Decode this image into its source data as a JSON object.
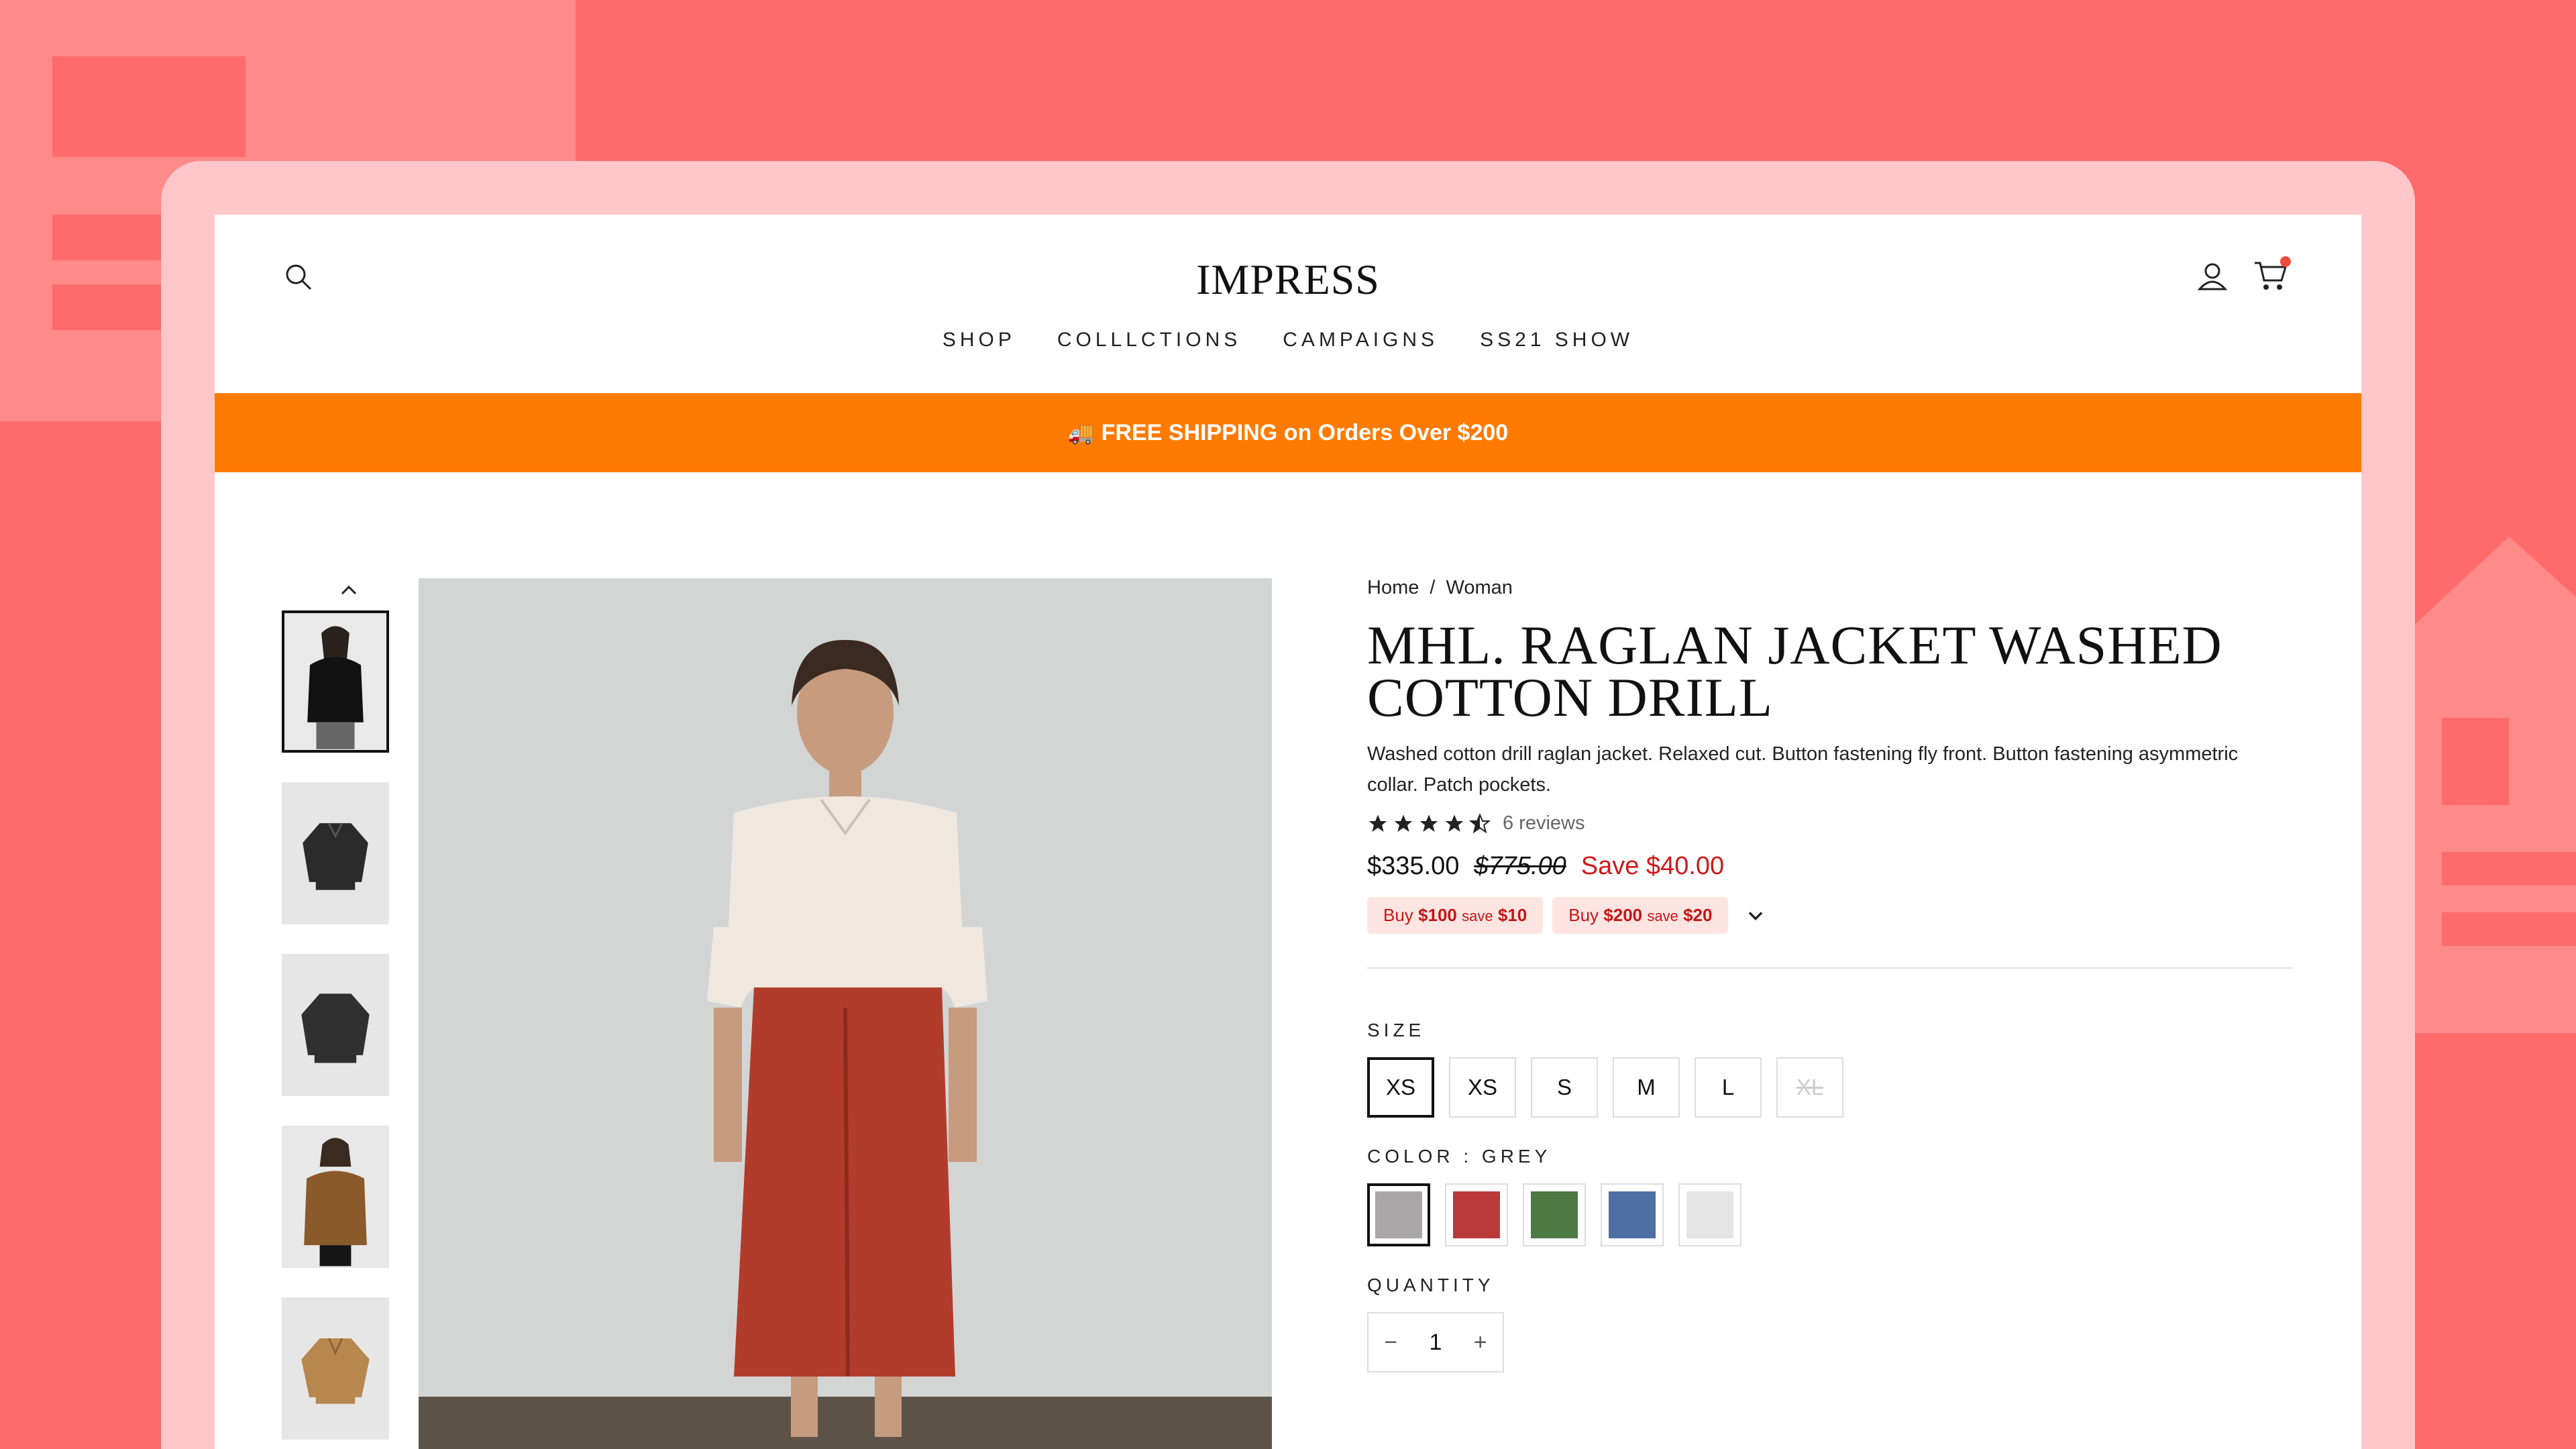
{
  "colors": {
    "background": "#ff6b6b",
    "banner": "#ff7a00",
    "sale": "#d01a1a",
    "offer_bg": "#ffe5e2"
  },
  "header": {
    "logo": "IMPRESS",
    "nav": [
      "SHOP",
      "COLLLCTIONS",
      "CAMPAIGNS",
      "SS21 SHOW"
    ],
    "icons": [
      "search-icon",
      "account-icon",
      "cart-icon"
    ]
  },
  "banner": {
    "icon": "truck-icon",
    "text": "FREE SHIPPING on Orders Over $200"
  },
  "product": {
    "breadcrumb": {
      "home": "Home",
      "separator": "/",
      "current": "Woman"
    },
    "title": "MHL. RAGLAN JACKET WASHED COTTON DRILL",
    "description": "Washed cotton drill raglan jacket. Relaxed cut. Button fastening fly front. Button fastening asymmetric collar. Patch pockets.",
    "rating": 4.5,
    "reviews": "6 reviews",
    "price": "$335.00",
    "compare_price": "$775.00",
    "save": "Save $40.00",
    "offers": [
      {
        "prefix": "Buy",
        "amount": "$100",
        "mid": "save",
        "discount": "$10"
      },
      {
        "prefix": "Buy",
        "amount": "$200",
        "mid": "save",
        "discount": "$20"
      }
    ]
  },
  "size": {
    "label": "SIZE",
    "options": [
      "XS",
      "XS",
      "S",
      "M",
      "L",
      "XL"
    ],
    "selected_index": 0,
    "disabled_index": 5
  },
  "color": {
    "label": "COLOR : GREY",
    "swatches": [
      "#a9a7a8",
      "#b83a3a",
      "#4c7a42",
      "#4d6fa4",
      "#e5e5e5"
    ],
    "selected_index": 0
  },
  "quantity": {
    "label": "QUANTITY",
    "minus": "−",
    "value": "1",
    "plus": "+"
  },
  "thumbnails": [
    "black jacket model",
    "black jacket flat",
    "black jacket flat back",
    "brown jacket model",
    "tan jacket flat"
  ]
}
